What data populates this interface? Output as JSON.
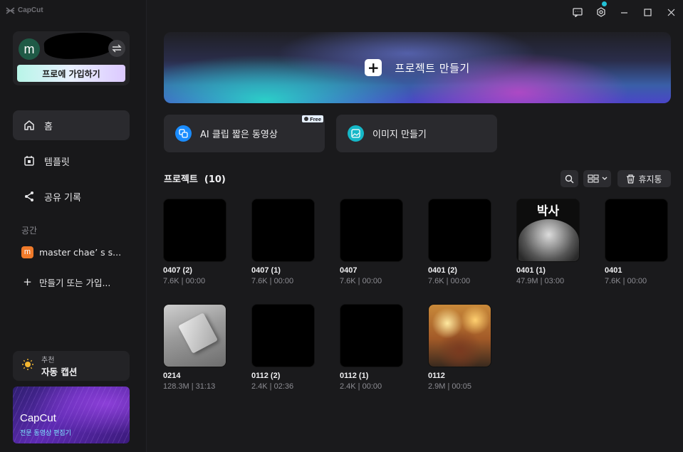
{
  "app": {
    "brand": "CapCut"
  },
  "profile": {
    "avatar_letter": "m",
    "pro_button": "프로에 가입하기"
  },
  "sidebar": {
    "nav": [
      {
        "label": "홈",
        "icon": "home-icon"
      },
      {
        "label": "템플릿",
        "icon": "template-icon"
      },
      {
        "label": "공유 기록",
        "icon": "share-icon"
      }
    ],
    "section_label": "공간",
    "space": {
      "badge": "m",
      "name": "master chae’ s s..."
    },
    "create_join": "만들기 또는 가입..."
  },
  "recommend": {
    "small": "추천",
    "title": "자동 캡션"
  },
  "promo": {
    "title": "CapCut",
    "subtitle": "전문 동영상 편집기"
  },
  "hero": {
    "label": "프로젝트 만들기"
  },
  "quick": {
    "ai_clip": {
      "label": "AI 클립 짧은 동영상",
      "badge": "Free"
    },
    "image": {
      "label": "이미지 만들기"
    }
  },
  "projects": {
    "header": "프로젝트  (10)",
    "trash_label": "휴지통",
    "items": [
      {
        "name": "0407 (2)",
        "meta": "7.6K | 00:00"
      },
      {
        "name": "0407 (1)",
        "meta": "7.6K | 00:00"
      },
      {
        "name": "0407",
        "meta": "7.6K | 00:00"
      },
      {
        "name": "0401 (2)",
        "meta": "7.6K | 00:00"
      },
      {
        "name": "0401 (1)",
        "meta": "47.9M | 03:00",
        "thumb_text": "박사"
      },
      {
        "name": "0401",
        "meta": "7.6K | 00:00"
      },
      {
        "name": "0214",
        "meta": "128.3M | 31:13"
      },
      {
        "name": "0112 (2)",
        "meta": "2.4K | 02:36"
      },
      {
        "name": "0112 (1)",
        "meta": "2.4K | 00:00"
      },
      {
        "name": "0112",
        "meta": "2.9M | 00:05"
      }
    ]
  },
  "colors": {
    "bg": "#1a1a1c",
    "accent": "#22c1d6",
    "space_badge": "#f07a2a"
  }
}
